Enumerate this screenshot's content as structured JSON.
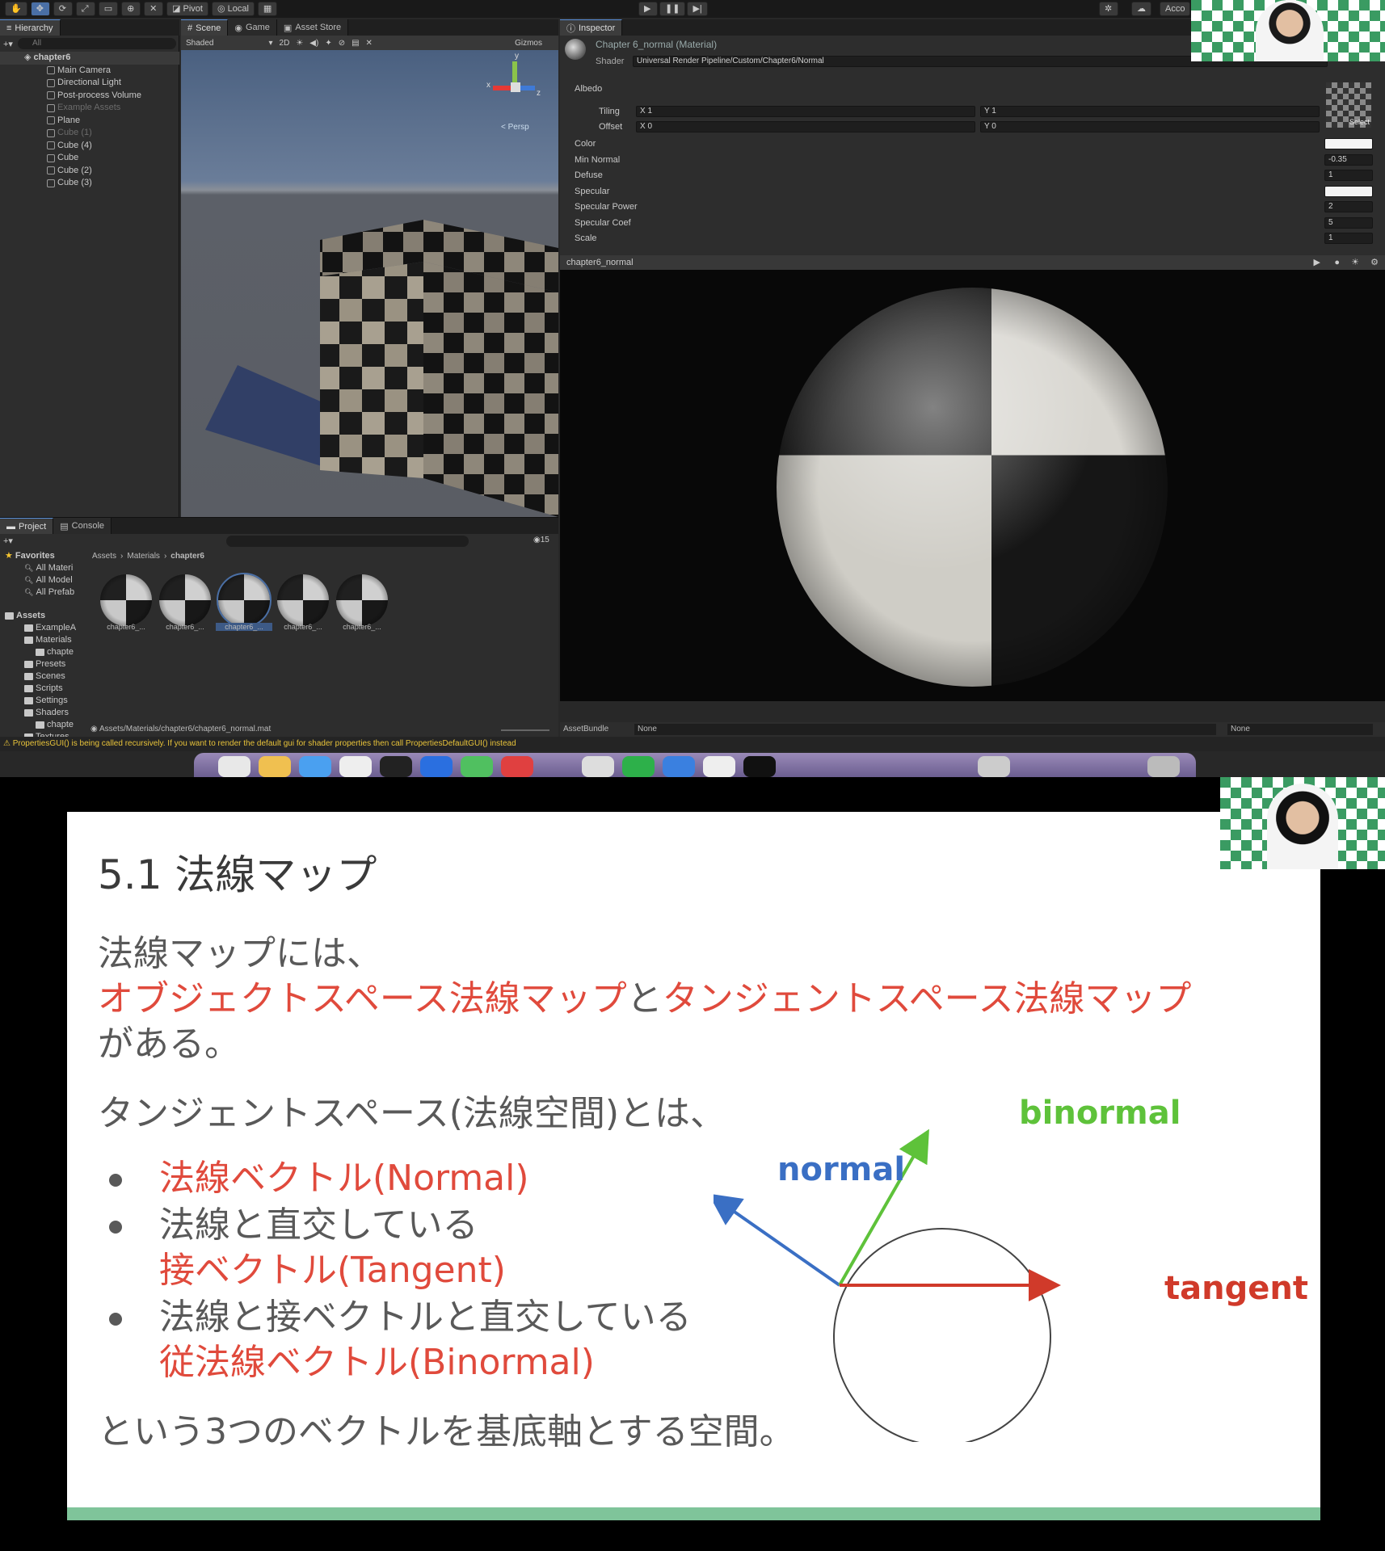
{
  "unity": {
    "toolbar": {
      "pivot": "Pivot",
      "local": "Local",
      "account": "Acco"
    },
    "hierarchy": {
      "tab": "Hierarchy",
      "search_placeholder": "All",
      "scene_root": "chapter6",
      "items": [
        {
          "label": "Main Camera",
          "dim": false
        },
        {
          "label": "Directional Light",
          "dim": false
        },
        {
          "label": "Post-process Volume",
          "dim": false
        },
        {
          "label": "Example Assets",
          "dim": true
        },
        {
          "label": "Plane",
          "dim": false
        },
        {
          "label": "Cube (1)",
          "dim": true
        },
        {
          "label": "Cube (4)",
          "dim": false
        },
        {
          "label": "Cube",
          "dim": false
        },
        {
          "label": "Cube (2)",
          "dim": false
        },
        {
          "label": "Cube (3)",
          "dim": false
        }
      ]
    },
    "scene": {
      "tabs": [
        "Scene",
        "Game",
        "Asset Store"
      ],
      "shading": "Shaded",
      "mode_2d": "2D",
      "gizmos": "Gizmos",
      "persp": "Persp",
      "gizmo_axes": {
        "x": "x",
        "y": "y",
        "z": "z"
      }
    },
    "inspector": {
      "tab": "Inspector",
      "material_name": "Chapter 6_normal (Material)",
      "shader_label": "Shader",
      "shader_value": "Universal Render Pipeline/Custom/Chapter6/Normal",
      "albedo": "Albedo",
      "tiling": {
        "label": "Tiling",
        "x": "X 1",
        "y": "Y 1"
      },
      "offset": {
        "label": "Offset",
        "x": "X 0",
        "y": "Y 0"
      },
      "select": "Select",
      "properties": [
        {
          "label": "Color",
          "value": ""
        },
        {
          "label": "Min Normal",
          "value": "-0.35"
        },
        {
          "label": "Defuse",
          "value": "1"
        },
        {
          "label": "Specular",
          "value": ""
        },
        {
          "label": "Specular Power",
          "value": "2"
        },
        {
          "label": "Specular Coef",
          "value": "5"
        },
        {
          "label": "Scale",
          "value": "1"
        }
      ],
      "preview_title": "chapter6_normal",
      "assetbundle_label": "AssetBundle",
      "assetbundle_value": "None",
      "assetbundle_variant": "None"
    },
    "project": {
      "tabs": [
        "Project",
        "Console"
      ],
      "favorites": "Favorites",
      "favorite_items": [
        "All Materi",
        "All Model",
        "All Prefab"
      ],
      "assets": "Assets",
      "asset_items": [
        "ExampleA",
        "Materials",
        "chapte",
        "Presets",
        "Scenes",
        "Scripts",
        "Settings",
        "Shaders",
        "chapte",
        "Textures"
      ],
      "breadcrumb": [
        "Assets",
        "Materials",
        "chapter6"
      ],
      "count": "15",
      "materials": [
        "chapter6_...",
        "chapter6_...",
        "chapter6_...",
        "chapter6_...",
        "chapter6_..."
      ],
      "selected_path": "Assets/Materials/chapter6/chapter6_normal.mat"
    },
    "status_message": "PropertiesGUI() is being called recursively. If you want to render the default gui for shader properties then call PropertiesDefaultGUI() instead"
  },
  "slide": {
    "title": "5.1 法線マップ",
    "line1": "法線マップには、",
    "line2_red1": "オブジェクトスペース法線マップ",
    "line2_mid": "と",
    "line2_red2": "タンジェントスペース法線マップ",
    "line3": "がある。",
    "line4": "タンジェントスペース(法線空間)とは、",
    "bullets": [
      {
        "black": "",
        "red": "法線ベクトル(Normal)"
      },
      {
        "black": "法線と直交している",
        "red": "接ベクトル(Tangent)"
      },
      {
        "black": "法線と接ベクトルと直交している",
        "red": "従法線ベクトル(Binormal)"
      }
    ],
    "closing": "という3つのベクトルを基底軸とする空間。",
    "diagram": {
      "normal": "normal",
      "binormal": "binormal",
      "tangent": "tangent",
      "normal_color": "#3a6fc4",
      "binormal_color": "#5ec23a",
      "tangent_color": "#d03a2a"
    }
  }
}
